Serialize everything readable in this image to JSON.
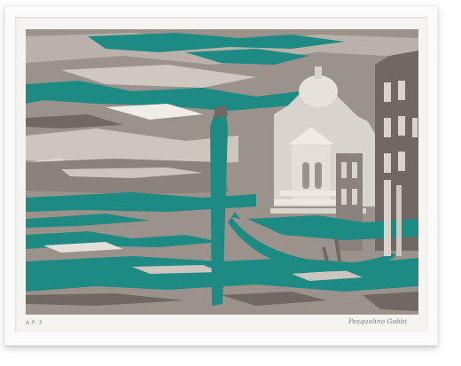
{
  "artwork": {
    "edition_mark": "A.P. 3",
    "signature": "Pasqualino Gobbi",
    "colors": {
      "teal": "#1e8a84",
      "taupe": "#9a928b",
      "light": "#d8d3cd",
      "dark_grey": "#6f6863",
      "paper": "#f6f4f1"
    }
  }
}
